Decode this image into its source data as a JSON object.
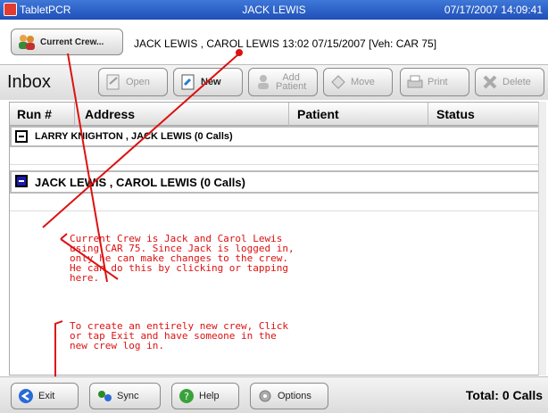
{
  "titlebar": {
    "app": "TabletPCR",
    "user": "JACK LEWIS",
    "clock": "07/17/2007 14:09:41"
  },
  "crew": {
    "button_label": "Current Crew...",
    "info": "JACK LEWIS , CAROL LEWIS  13:02 07/15/2007 [Veh: CAR 75]"
  },
  "toolbar": {
    "title": "Inbox",
    "open": "Open",
    "new": "New",
    "add_patient_1": "Add",
    "add_patient_2": "Patient",
    "move": "Move",
    "print": "Print",
    "delete": "Delete"
  },
  "grid": {
    "headers": [
      "Run #",
      "Address",
      "Patient",
      "Status"
    ],
    "groups": [
      {
        "label": "LARRY KNIGHTON , JACK LEWIS  (0 Calls)"
      },
      {
        "label": "JACK LEWIS ,  CAROL LEWIS  (0  Calls)"
      }
    ]
  },
  "annotations": {
    "note1": "Current Crew is Jack and Carol Lewis\nusing CAR 75. Since Jack is logged in,\nonly he can make changes to the crew.\nHe can do this by clicking or tapping\nhere.",
    "note2": "To create an entirely new crew, Click\nor tap Exit and have someone in the\nnew crew log in."
  },
  "bottombar": {
    "exit": "Exit",
    "sync": "Sync",
    "help": "Help",
    "options": "Options",
    "total": "Total: 0 Calls"
  },
  "colors": {
    "title_blue": "#1f4fb8",
    "annotation_red": "#d11111"
  }
}
